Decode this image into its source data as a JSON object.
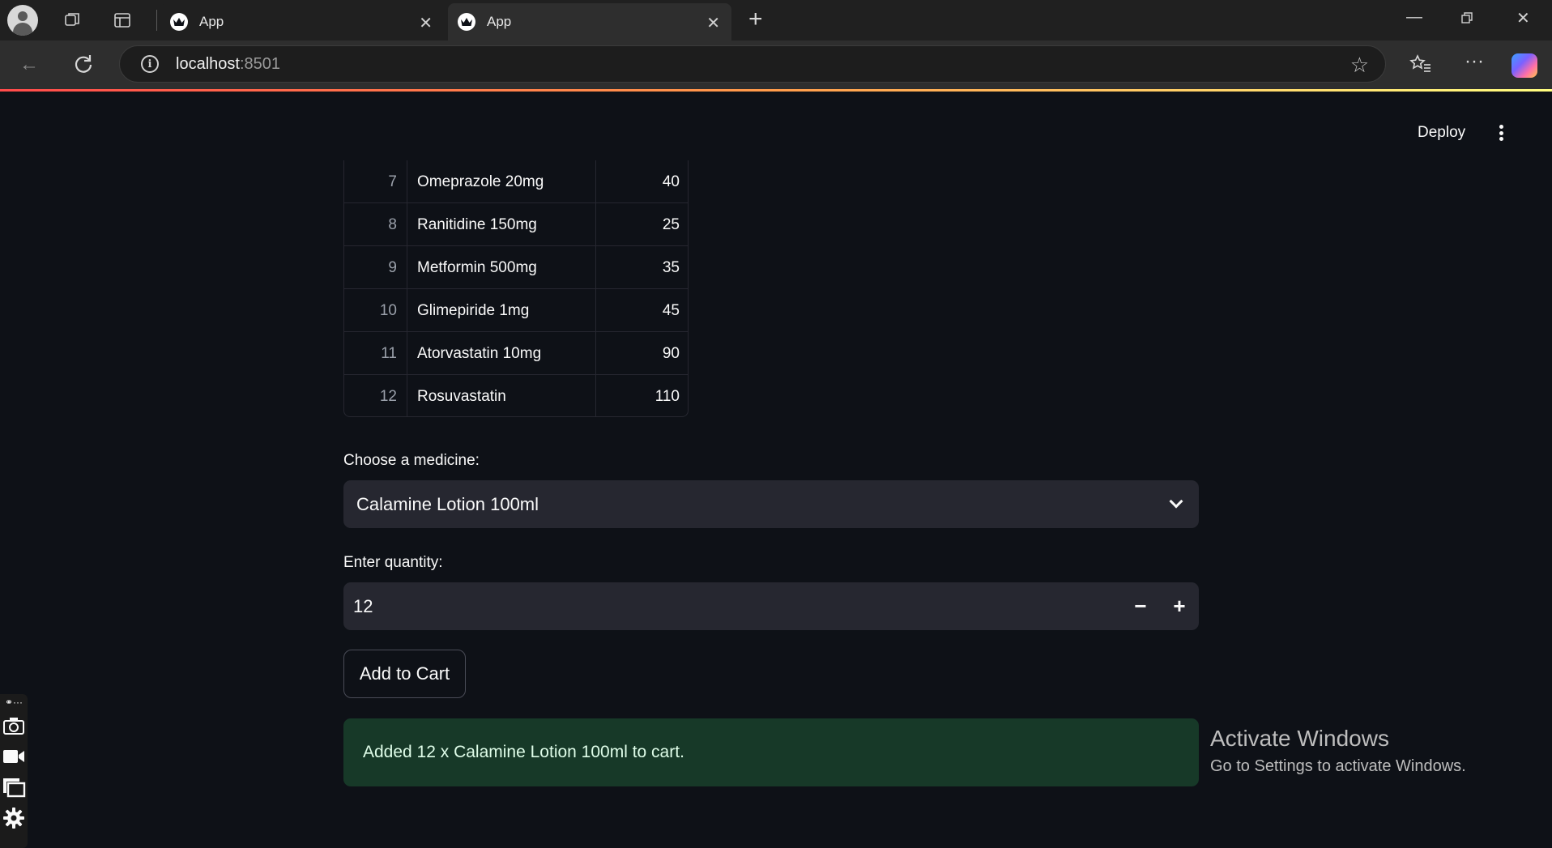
{
  "browser": {
    "tabs": [
      {
        "title": "App",
        "active": false
      },
      {
        "title": "App",
        "active": true
      }
    ],
    "address": {
      "host": "localhost",
      "port": ":8501"
    }
  },
  "header": {
    "deploy_label": "Deploy"
  },
  "table": {
    "rows": [
      {
        "index": "7",
        "name": "Omeprazole 20mg",
        "value": "40"
      },
      {
        "index": "8",
        "name": "Ranitidine 150mg",
        "value": "25"
      },
      {
        "index": "9",
        "name": "Metformin 500mg",
        "value": "35"
      },
      {
        "index": "10",
        "name": "Glimepiride 1mg",
        "value": "45"
      },
      {
        "index": "11",
        "name": "Atorvastatin 10mg",
        "value": "90"
      },
      {
        "index": "12",
        "name": "Rosuvastatin",
        "value": "110"
      }
    ]
  },
  "form": {
    "medicine_label": "Choose a medicine:",
    "medicine_value": "Calamine Lotion 100ml",
    "quantity_label": "Enter quantity:",
    "quantity_value": "12",
    "minus": "−",
    "plus": "+",
    "add_button": "Add to Cart"
  },
  "alert": {
    "message": "Added 12 x Calamine Lotion 100ml to cart.",
    "color": "#173928"
  },
  "watermark": {
    "title": "Activate Windows",
    "subtitle": "Go to Settings to activate Windows."
  },
  "colors": {
    "background": "#0e1117",
    "widget": "#262730",
    "accent_start": "#ff4b4b",
    "accent_end": "#fffd80"
  }
}
